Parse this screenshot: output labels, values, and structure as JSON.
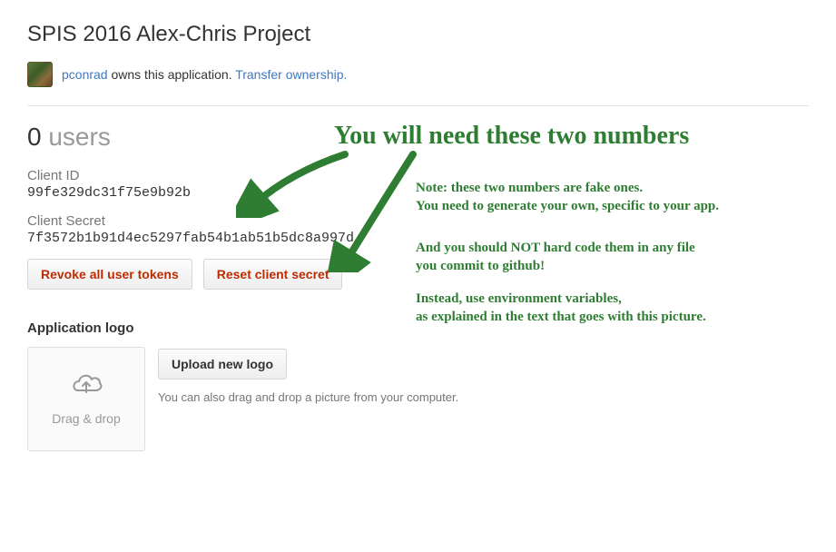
{
  "title": "SPIS 2016 Alex-Chris Project",
  "owner": {
    "username": "pconrad",
    "owns_text": " owns this application. ",
    "transfer_link": "Transfer ownership."
  },
  "users": {
    "count": "0",
    "label": " users"
  },
  "client_id": {
    "label": "Client ID",
    "value": "99fe329dc31f75e9b92b"
  },
  "client_secret": {
    "label": "Client Secret",
    "value": "7f3572b1b91d4ec5297fab54b1ab51b5dc8a997d"
  },
  "buttons": {
    "revoke": "Revoke all user tokens",
    "reset": "Reset client secret",
    "upload": "Upload new logo"
  },
  "logo_section": {
    "heading": "Application logo",
    "dropzone": "Drag & drop",
    "hint": "You can also drag and drop a picture from your computer."
  },
  "annotations": {
    "headline": "You will need these two numbers",
    "note1": "Note: these two numbers are fake ones.\nYou need to generate your own, specific to your app.",
    "note2": "And you should NOT hard code them in any file\nyou commit to github!",
    "note3": "Instead, use environment variables,\nas explained in the text that goes with this picture."
  }
}
